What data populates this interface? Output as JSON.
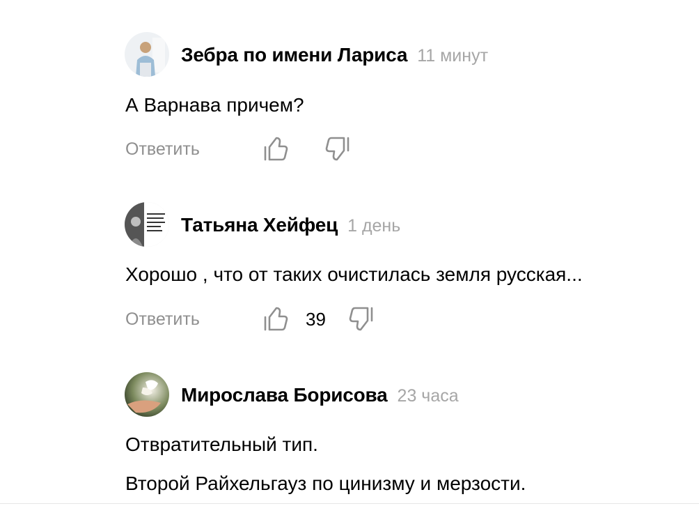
{
  "comments": [
    {
      "author": "Зебра по имени Лариса",
      "time": "11 минут",
      "text": [
        "А Варнава причем?"
      ],
      "reply_label": "Ответить",
      "likes": ""
    },
    {
      "author": "Татьяна Хейфец",
      "time": "1 день",
      "text": [
        "Хорошо , что от таких очистилась земля русская..."
      ],
      "reply_label": "Ответить",
      "likes": "39"
    },
    {
      "author": "Мирослава Борисова",
      "time": "23 часа",
      "text": [
        "Отвратительный тип.",
        "Второй Райхельгауз по цинизму и мерзости."
      ]
    }
  ],
  "icons": {
    "like": "thumb-up-icon",
    "dislike": "thumb-down-icon"
  },
  "colors": {
    "text": "#000000",
    "muted": "#8f8f8f",
    "time": "#a6a6a6"
  }
}
